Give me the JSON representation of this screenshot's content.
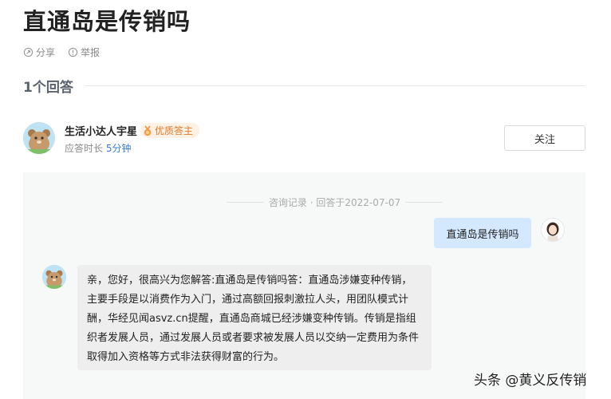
{
  "question": {
    "title": "直通岛是传销吗"
  },
  "actions": {
    "share_label": "分享",
    "report_label": "举报"
  },
  "answers": {
    "count_label": "1个回答"
  },
  "answerer": {
    "name": "生活小达人宇星",
    "badge": "优质答主",
    "response_time_prefix": "应答时长 ",
    "response_time_value": "5分钟"
  },
  "follow_button": {
    "label": "关注"
  },
  "chat": {
    "record_label": "咨询记录 · 回答于2022-07-07",
    "question_text": "直通岛是传销吗",
    "answer_text": "亲，您好，很高兴为您解答:直通岛是传销吗答：直通岛涉嫌变种传销，主要手段是以消费作为入门，通过高额回报刺激拉人头，用团队模式计酬，华经见闻asvz.cn提醒，直通岛商城已经涉嫌变种传销。传销是指组织者发展人员，通过发展人员或者要求被发展人员以交纳一定费用为条件取得加入资格等方式非法获得财富的行为。"
  },
  "watermark": {
    "text": "头条 @黄义反传销"
  },
  "colors": {
    "accent_blue": "#3a7bd5",
    "badge_orange": "#e07a2a",
    "question_bubble": "#d4e9ff",
    "panel_bg": "#f7f8f8"
  },
  "icons": {
    "share": "share-icon",
    "report": "report-icon",
    "badge": "medal-icon"
  }
}
